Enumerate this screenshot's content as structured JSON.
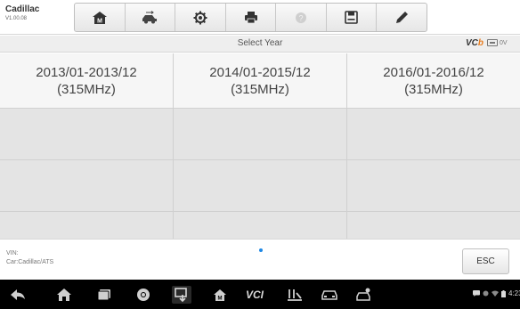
{
  "app": {
    "name": "Cadillac",
    "version": "V1.00.08"
  },
  "toolbar": {
    "buttons": [
      {
        "icon": "home-icon"
      },
      {
        "icon": "vehicle-swap-icon"
      },
      {
        "icon": "settings-icon"
      },
      {
        "icon": "print-icon"
      },
      {
        "icon": "help-icon-disabled"
      },
      {
        "icon": "save-icon"
      },
      {
        "icon": "edit-icon"
      }
    ]
  },
  "subheader": {
    "title": "Select Year",
    "vci_prefix": "VC",
    "vci_suffix": "b",
    "battery_label": "0V"
  },
  "options": [
    {
      "line1": "2013/01-2013/12",
      "line2": "(315MHz)"
    },
    {
      "line1": "2014/01-2015/12",
      "line2": "(315MHz)"
    },
    {
      "line1": "2016/01-2016/12",
      "line2": "(315MHz)"
    }
  ],
  "info": {
    "vin_label": "VIN:",
    "car_label": "Car:Cadillac/ATS",
    "esc_label": "ESC"
  },
  "navbar": {
    "vcl_label": "VCI",
    "time": "4:23"
  },
  "colors": {
    "accent": "#e87c1e",
    "page_dot": "#1e88e5"
  }
}
